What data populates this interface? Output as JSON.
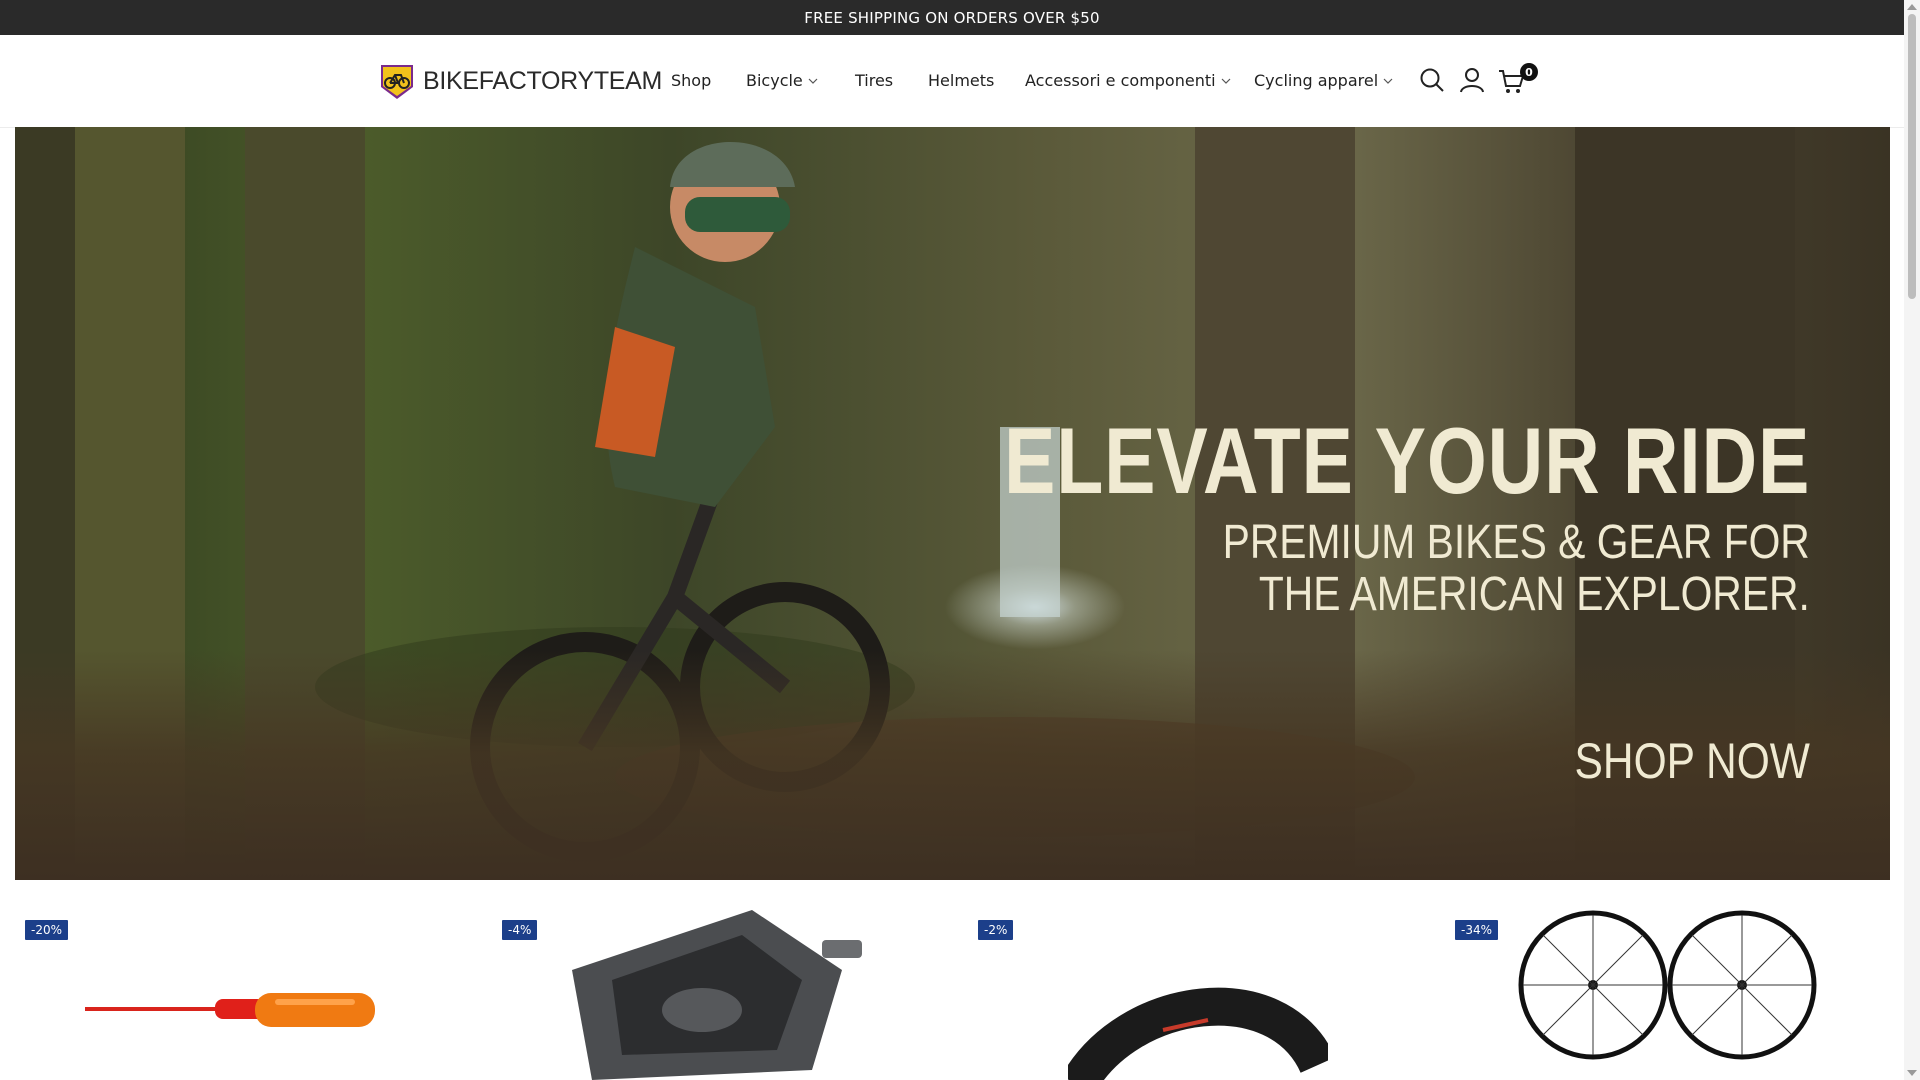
{
  "announcement": {
    "text": "FREE SHIPPING ON ORDERS OVER $50"
  },
  "brand": {
    "name": "BIKEFACTORYTEAM"
  },
  "nav": {
    "items": [
      {
        "label": "Shop",
        "has_dropdown": false
      },
      {
        "label": "Bicycle",
        "has_dropdown": true
      },
      {
        "label": "Tires",
        "has_dropdown": false
      },
      {
        "label": "Helmets",
        "has_dropdown": false
      },
      {
        "label": "Accessori e componenti",
        "has_dropdown": true
      },
      {
        "label": "Cycling apparel",
        "has_dropdown": true
      }
    ]
  },
  "header_icons": {
    "search": "search-icon",
    "account": "user-icon",
    "cart": "cart-icon",
    "cart_count": "0"
  },
  "hero": {
    "title": "ELEVATE YOUR RIDE",
    "subtitle_line1": "PREMIUM BIKES & GEAR FOR",
    "subtitle_line2": "THE AMERICAN EXPLORER.",
    "cta": "SHOP NOW"
  },
  "products": [
    {
      "badge": "-20%",
      "image": "screwdriver"
    },
    {
      "badge": "-4%",
      "image": "pedal"
    },
    {
      "badge": "-2%",
      "image": "tire"
    },
    {
      "badge": "-34%",
      "image": "wheelset"
    }
  ],
  "colors": {
    "announcement_bg": "#2a2a2a",
    "badge_bg": "#1c3f8a",
    "hero_text": "#f0ead2"
  }
}
